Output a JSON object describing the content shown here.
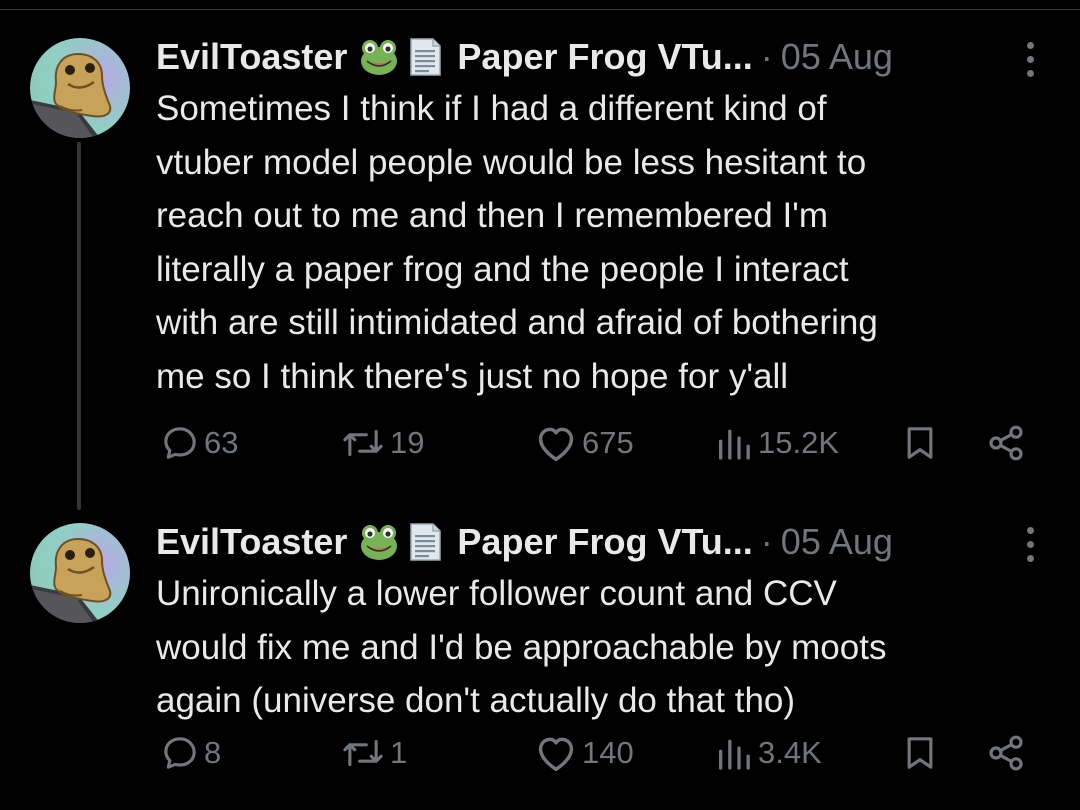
{
  "colors": {
    "background": "#000000",
    "text": "#e7e9ea",
    "muted": "#71767b",
    "thread_line": "#333639"
  },
  "tweets": [
    {
      "author": {
        "display_name": "EvilToaster",
        "badge_emojis": [
          "frog-face-emoji",
          "page-facing-up-emoji"
        ],
        "name_suffix": "Paper Frog VTu...",
        "avatar": "paper-frog-avatar"
      },
      "separator": "·",
      "date": "05 Aug",
      "text": "Sometimes I think if I had a different kind of\nvtuber model people would be less hesitant to\nreach out to me and then I remembered I'm\nliterally a paper frog and the people I interact\nwith are still intimidated and afraid of bothering\nme so I think there's just no hope for y'all",
      "stats": {
        "replies": "63",
        "reposts": "19",
        "likes": "675",
        "views": "15.2K"
      }
    },
    {
      "author": {
        "display_name": "EvilToaster",
        "badge_emojis": [
          "frog-face-emoji",
          "page-facing-up-emoji"
        ],
        "name_suffix": "Paper Frog VTu...",
        "avatar": "paper-frog-avatar"
      },
      "separator": "·",
      "date": "05 Aug",
      "text": "Unironically a lower follower count and CCV\nwould fix me and I'd be approachable by moots\nagain (universe don't actually do that tho)",
      "stats": {
        "replies": "8",
        "reposts": "1",
        "likes": "140",
        "views": "3.4K"
      }
    }
  ]
}
